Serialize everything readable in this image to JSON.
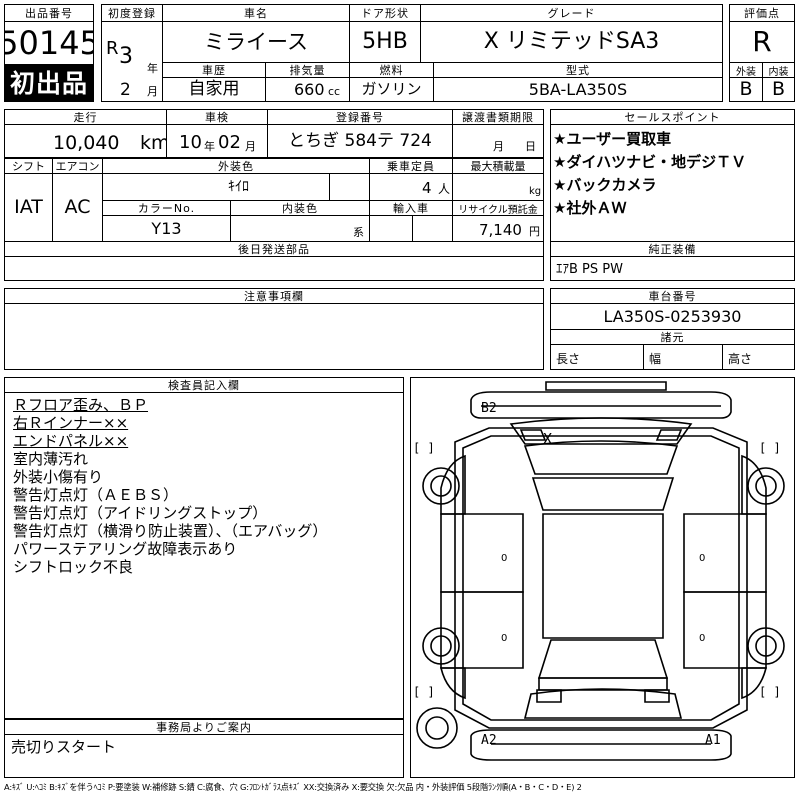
{
  "lot": {
    "label": "出品番号",
    "number": "50145",
    "badge": "初出品"
  },
  "registration": {
    "first_reg_label": "初度登録",
    "era": "R",
    "year": "3",
    "year_unit": "年",
    "month": "2",
    "month_unit": "月"
  },
  "vehicle": {
    "name_label": "車名",
    "name": "ミライース",
    "door_label": "ドア形状",
    "door": "5HB",
    "grade_label": "グレード",
    "grade": "X リミテッドSA3",
    "history_label": "車歴",
    "history": "自家用",
    "displacement_label": "排気量",
    "displacement": "660",
    "displacement_unit": "cc",
    "fuel_label": "燃料",
    "fuel": "ガソリン",
    "model_label": "型式",
    "model": "5BA-LA350S"
  },
  "score": {
    "label": "評価点",
    "value": "R",
    "exterior_label": "外装",
    "exterior": "B",
    "interior_label": "内装",
    "interior": "B"
  },
  "mileage": {
    "label": "走行",
    "value": "10,040",
    "unit": "km"
  },
  "inspection": {
    "label": "車検",
    "year": "10",
    "year_unit": "年",
    "month": "02",
    "month_unit": "月"
  },
  "plate": {
    "label": "登録番号",
    "value": "とちぎ 584テ 724"
  },
  "transfer_period": {
    "label": "譲渡書類期限",
    "month_unit": "月",
    "day_unit": "日"
  },
  "sales_points": {
    "label": "セールスポイント",
    "items": [
      "★ユーザー買取車",
      "★ダイハツナビ・地デジＴＶ",
      "★バックカメラ",
      "★社外ＡＷ"
    ]
  },
  "specs": {
    "shift_label": "シフト",
    "shift": "IAT",
    "ac_label": "エアコン",
    "ac": "AC",
    "ext_color_label": "外装色",
    "ext_color": "ｷｲﾛ",
    "capacity_label": "乗車定員",
    "capacity": "4",
    "capacity_unit": "人",
    "max_load_label": "最大積載量",
    "max_load_unit": "kg",
    "color_no_label": "カラーNo.",
    "color_no": "Y13",
    "int_color_label": "内装色",
    "int_color_unit": "系",
    "import_label": "輸入車",
    "recycle_label": "リサイクル預託金",
    "recycle": "7,140",
    "recycle_unit": "円"
  },
  "later_parts": {
    "label": "後日発送部品"
  },
  "genuine": {
    "label": "純正装備",
    "value": "ｴｱB PS PW"
  },
  "caution": {
    "label": "注意事項欄"
  },
  "chassis": {
    "label": "車台番号",
    "value": "LA350S-0253930"
  },
  "dimensions": {
    "label": "諸元",
    "length_label": "長さ",
    "width_label": "幅",
    "height_label": "高さ"
  },
  "inspector": {
    "label": "検査員記入欄",
    "lines": [
      "Ｒフロア歪み、ＢＰ",
      "右Ｒインナー××",
      "エンドパネル××",
      "室内薄汚れ",
      "外装小傷有り",
      "警告灯点灯（ＡＥＢＳ）",
      "警告灯点灯（アイドリングストップ）",
      "警告灯点灯（横滑り防止装置）、（エアバッグ）",
      "パワーステアリング故障表示あり",
      "シフトロック不良"
    ]
  },
  "office": {
    "label": "事務局よりご案内",
    "text": "売切りスタート"
  },
  "diagram": {
    "b2": "B2",
    "a2": "A2",
    "a1": "A1",
    "x_mark": "X",
    "zero": "0",
    "bracket": "[ ]"
  },
  "legend": "A:ｷｽﾞ U:ﾍｺﾐ B:ｷｽﾞを伴うﾍｺﾐ P:要塗装 W:補修跡 S:錆 C:腐食、穴 G:ﾌﾛﾝﾄｶﾞﾗｽ点ｷｽﾞ XX:交換済み X:要交換 欠:欠品 内・外装評価 5段階ﾗﾝｸ順(A・B・C・D・E) 2"
}
